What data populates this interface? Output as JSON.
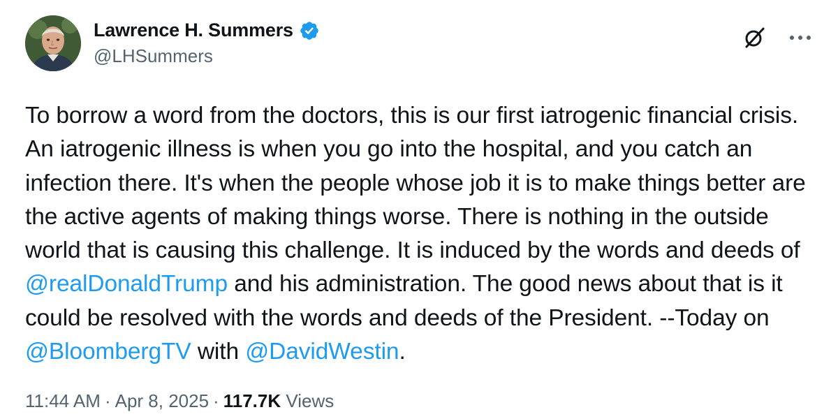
{
  "author": {
    "display_name": "Lawrence H. Summers",
    "handle": "@LHSummers",
    "verified_icon": "verified-badge-icon",
    "avatar_icon": "avatar-portrait"
  },
  "actions": {
    "grok_icon": "grok-icon",
    "more_icon": "more-options-icon"
  },
  "tweet": {
    "text_part1": "To borrow a word from the doctors, this is our first iatrogenic financial crisis. An iatrogenic illness is when you go into the hospital, and you catch an infection there. It's when the people whose job it is to make things better are the active agents of making things worse. There is nothing in the outside world that is causing this challenge. It is induced by the words and deeds of ",
    "mention1": "@realDonaldTrump",
    "text_part2": " and his administration. The good news about that is it could be resolved with the words and deeds of the President. --Today on ",
    "mention2": "@BloombergTV",
    "text_part3": " with ",
    "mention3": "@DavidWestin",
    "text_part4": "."
  },
  "meta": {
    "time": "11:44 AM",
    "separator": "·",
    "date": "Apr 8, 2025",
    "views_count": "117.7K",
    "views_label": "Views"
  },
  "colors": {
    "text": "#0f1419",
    "secondary": "#536471",
    "link": "#1d9bf0",
    "verified": "#1d9bf0"
  }
}
